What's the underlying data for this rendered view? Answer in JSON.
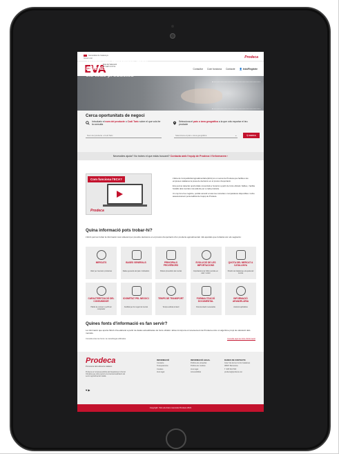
{
  "top": {
    "generalitat": "Generalitat de Catalunya Govern.cat",
    "brand_top": "Prodeca"
  },
  "header": {
    "logo": "EVA",
    "logo_sub": "Eina de Valoració Agroalimentària",
    "nav": [
      "Consultor",
      "Com funciona",
      "Contacte"
    ],
    "login": "Inici/Registre"
  },
  "hero": {
    "line1_pre": "Troba els ",
    "line1_bold": "mercats més",
    "line2": "adients per exportar",
    "line3": "els teus productes"
  },
  "search": {
    "title": "Cerca oportunitats de negoci",
    "step1_pre": "Introdueix el ",
    "step1_red": "nom del producte",
    "step1_mid": " o ",
    "step1_red2": "Codi Taric",
    "step1_post": " sobre el que vols fer la consulta",
    "step2_pre": "Selecciona el ",
    "step2_red": "país o àrea geogràfica",
    "step2_post": " a la que vols exportar el teu producte",
    "input1_placeholder": "Nom del producte o Codi Taric",
    "input2_placeholder": "Selecciona el país o àrea geogràfica",
    "button": "CERCA"
  },
  "help": {
    "text": "Necessites ajuda? No trobes el que estàs buscant? ",
    "link": "Contacta amb l'equip de Prodeca i t'informarem  ›"
  },
  "video": {
    "tag": "Com funciona l'ECA?",
    "logo": "Prodeca"
  },
  "intro_paragraphs": [
    "L'Eina de Competitivitat Agroalimentària (ECA) és un servei de Prodeca que facilita a les empreses catalanes la presa de decisions en el procés d'exportació.",
    "Ens permet detectar oportunitats comercials a l'exterior a partir de fonts oficials i fiables, i facilita l'anàlisi dels mercats més adients per a cada producte.",
    "Un cop fet el teu registre, podràs accedir a totes les consultes i comparatives disponibles i rebre assessorament personalitzat de l'equip de Prodeca."
  ],
  "info": {
    "title": "Quina informació pots trobar-hi?",
    "desc": "L'ECA permet trobar la informació més rellevant per prendre decisions en el procés d'exportació d'un producte agroalimentari. Els apartats que trobaràs són els següents:",
    "cards": [
      {
        "title": "MERCATS",
        "desc": "Valor per mercats i productes"
      },
      {
        "title": "BASES GENERALS",
        "desc": "Dades generals del país i indicadors"
      },
      {
        "title": "PRINCIPALS PROVEÏDORS",
        "desc": "Països proveïdors del mercat"
      },
      {
        "title": "EVOLUCIÓ DE LES IMPORTACIONS",
        "desc": "Importacions de l'últim període en valor i volum"
      },
      {
        "title": "QUOTA DEL MERCAT A CATALUNYA",
        "desc": "Posició de Catalunya a la quota del mercat"
      },
      {
        "title": "CARACTERITZACIÓ DEL CONSUMIDOR",
        "desc": "Hàbits de consum i perfil del comprador"
      },
      {
        "title": "IDONEÏTAT PEL NEGOCI",
        "desc": "Facilitat per fer negoci al mercat"
      },
      {
        "title": "TEMPS DE TRANSPORT",
        "desc": "Temps estimat al destí"
      },
      {
        "title": "FORMALITZACIÓ DOCUMENTAL",
        "desc": "Documentació necessària"
      },
      {
        "title": "INFORMACIÓ ARANZELÀRIA",
        "desc": "Aranzels aplicables"
      }
    ]
  },
  "sources": {
    "title": "Quines fonts d'informació es fan servir?",
    "desc": "La informació que aporta l'ECA s'ha elaborat a partir de dades actualitzades de fonts oficials i altres incorpora el coneixement de Prodeca entre un algoritme propi de valoració dels mercats.",
    "small": "Consulta totes les fonts i la metodologia utilitzades.",
    "link": "Consulta aquí les fonts d'informació"
  },
  "footer": {
    "logo": "Prodeca",
    "logo_sub": "Promotora dels aliments catalans",
    "about": "Prodeca és l'empresa pública del Departament d'Acció Climàtica que dona suport a la internacionalització del sector agroalimentari català.",
    "social": "♥ ▶",
    "col1": {
      "heading": "INFORMACIÓ",
      "items": [
        "Contacte",
        "Transparència",
        "Cookies",
        "Avís legal"
      ]
    },
    "col2": {
      "heading": "INFORMACIÓ LEGAL",
      "items": [
        "Política de privacitat",
        "Política de cookies",
        "Avís legal",
        "Accessibilitat"
      ]
    },
    "col3": {
      "heading": "DADES DE CONTACTE",
      "items": [
        "Gran Via de les Corts Catalanes",
        "08007 Barcelona",
        "T. 935 524 500",
        "prodeca@prodeca.cat"
      ]
    },
    "copyright": "Copyright. Tots els drets reservats Prodeca 2021"
  }
}
